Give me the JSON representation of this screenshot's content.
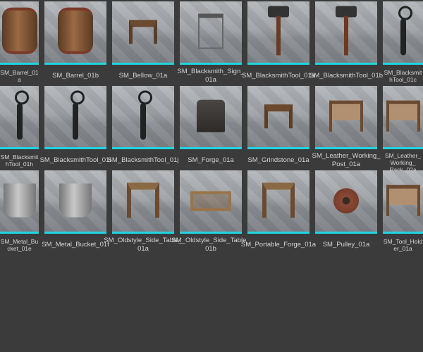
{
  "accent_color": "#1fd5e0",
  "assets": [
    {
      "name": "SM_Barrel_01a",
      "kind": "barrel"
    },
    {
      "name": "SM_Barrel_01b",
      "kind": "barrel"
    },
    {
      "name": "SM_Bellow_01a",
      "kind": "bench"
    },
    {
      "name": "SM_Blacksmith_Sign_\n01a",
      "kind": "sign"
    },
    {
      "name": "SM_BlacksmithTool_01a",
      "kind": "hammer"
    },
    {
      "name": "SM_BlacksmithTool_01b",
      "kind": "hammer"
    },
    {
      "name": "SM_BlacksmithTool_01c",
      "kind": "tongs"
    },
    {
      "name": "SM_BlacksmithTool_01h",
      "kind": "tongs"
    },
    {
      "name": "SM_BlacksmithTool_01i",
      "kind": "tongs"
    },
    {
      "name": "SM_BlacksmithTool_01j",
      "kind": "tongs"
    },
    {
      "name": "SM_Forge_01a",
      "kind": "forge"
    },
    {
      "name": "SM_Grindstone_01a",
      "kind": "bench"
    },
    {
      "name": "SM_Leather_Working_\nPost_01a",
      "kind": "rack"
    },
    {
      "name": "SM_Leather_Working_\nRack_02a",
      "kind": "rack"
    },
    {
      "name": "SM_Metal_Bucket_01e",
      "kind": "bucket"
    },
    {
      "name": "SM_Metal_Bucket_01f",
      "kind": "bucket"
    },
    {
      "name": "SM_Oldstyle_Side_Table_\n01a",
      "kind": "table"
    },
    {
      "name": "SM_Oldstyle_Side_Table_\n01b",
      "kind": "crate"
    },
    {
      "name": "SM_Portable_Forge_01a",
      "kind": "table"
    },
    {
      "name": "SM_Pulley_01a",
      "kind": "pulley"
    },
    {
      "name": "SM_Tool_Holder_01a",
      "kind": "rack"
    }
  ]
}
